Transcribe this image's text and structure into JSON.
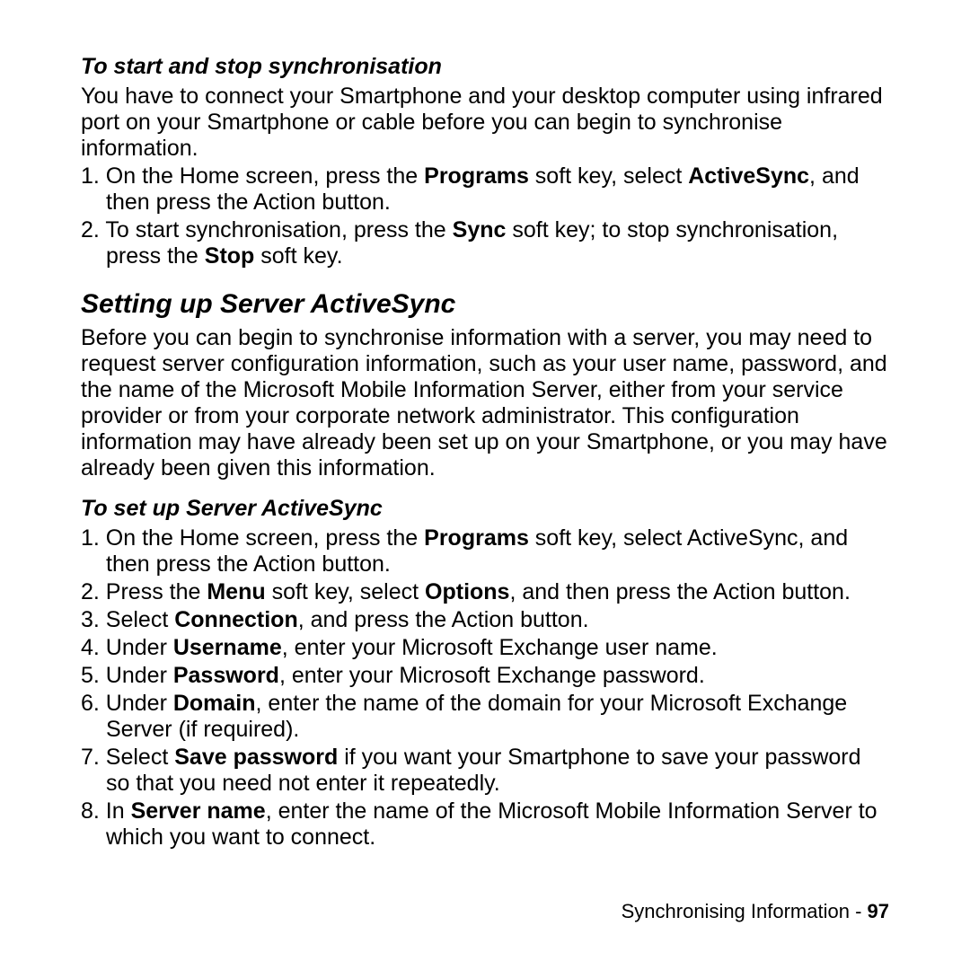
{
  "section1": {
    "subhead": "To start and stop synchronisation",
    "intro": "You have to connect your Smartphone and your desktop computer using infrared port on your Smartphone or cable before you can begin to synchronise information.",
    "items": [
      {
        "num": "1. ",
        "pre": "On the Home screen, press the ",
        "b1": "Programs",
        "mid1": " soft key, select ",
        "b2": "ActiveSync",
        "post": ", and then press the Action button."
      },
      {
        "num": "2. ",
        "pre": "To start synchronisation, press the ",
        "b1": "Sync",
        "mid1": " soft key; to stop synchronisation, press the ",
        "b2": "Stop",
        "post": " soft key."
      }
    ]
  },
  "section2": {
    "head": "Setting up Server ActiveSync",
    "intro": "Before you can begin to synchronise information with a server, you may need to request server configuration information, such as your user name, password, and the name of the Microsoft Mobile Information Server, either from your service provider or from your corporate network administrator. This configuration information may have already been set up on your Smartphone, or you may have already been given this information."
  },
  "section3": {
    "subhead": "To set up Server ActiveSync",
    "items": [
      {
        "num": "1. ",
        "pre": "On the Home screen, press the ",
        "b1": "Programs",
        "post": " soft key, select ActiveSync, and then press the Action button."
      },
      {
        "num": "2. ",
        "pre": "Press the ",
        "b1": "Menu",
        "mid1": " soft key, select ",
        "b2": "Options",
        "post": ", and then press the Action button."
      },
      {
        "num": "3. ",
        "pre": "Select ",
        "b1": "Connection",
        "post": ", and press the Action button."
      },
      {
        "num": "4. ",
        "pre": "Under ",
        "b1": "Username",
        "post": ", enter your Microsoft Exchange user name."
      },
      {
        "num": "5. ",
        "pre": "Under ",
        "b1": "Password",
        "post": ", enter your Microsoft Exchange password."
      },
      {
        "num": "6. ",
        "pre": "Under ",
        "b1": "Domain",
        "post": ", enter the name of the domain for your Microsoft Exchange Server (if required)."
      },
      {
        "num": "7. ",
        "pre": "Select ",
        "b1": "Save password",
        "post": " if you want your Smartphone to save your password so that you need not enter it repeatedly."
      },
      {
        "num": "8. ",
        "pre": "In ",
        "b1": "Server name",
        "post": ", enter the name of the Microsoft Mobile Information Server to which you want to connect."
      }
    ]
  },
  "footer": {
    "label": "Synchronising Information - ",
    "page": "97"
  }
}
